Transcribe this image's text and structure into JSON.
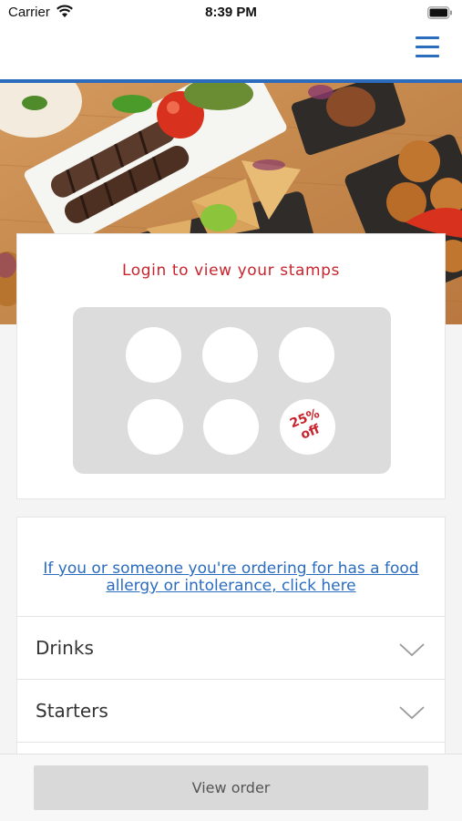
{
  "status_bar": {
    "carrier": "Carrier",
    "time": "8:39 PM"
  },
  "nav": {
    "menu_icon": "hamburger-menu-icon",
    "accent_color": "#2b6cbf"
  },
  "hero": {
    "image": "food-platter-photo"
  },
  "stamps": {
    "title": "Login to view your stamps",
    "total": 6,
    "collected": 0,
    "reward_label": "25% off",
    "reward_color": "#c8242d"
  },
  "allergy": {
    "link_text": "If you or someone you're ordering for has a food allergy or intolerance, click here"
  },
  "categories": [
    {
      "label": "Drinks"
    },
    {
      "label": "Starters"
    }
  ],
  "footer": {
    "view_order_label": "View order"
  }
}
